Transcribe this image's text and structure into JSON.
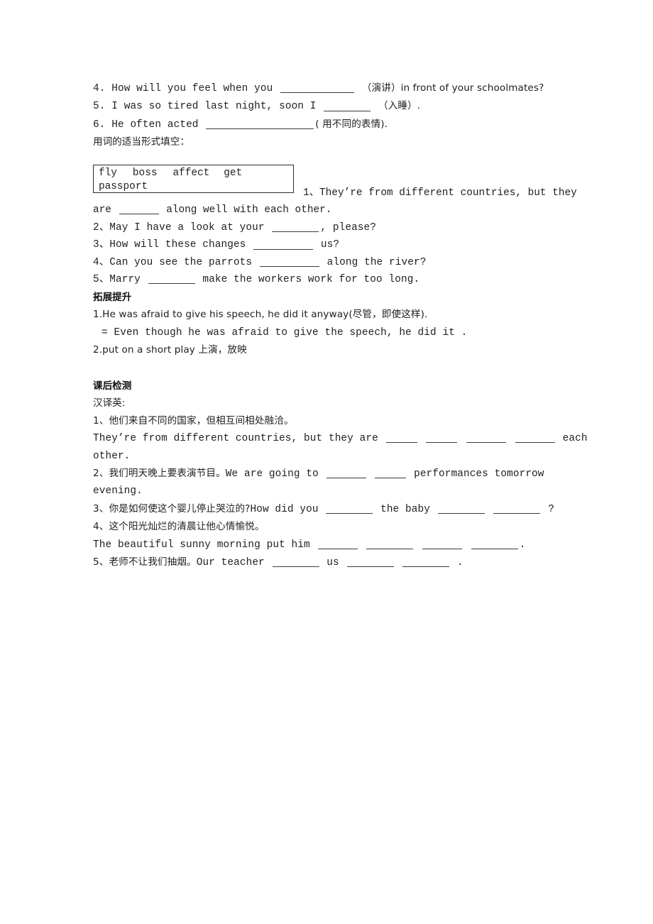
{
  "document": {
    "page_background": "#ffffff",
    "text_color": "#1e1e1e"
  },
  "section_top": {
    "items": [
      {
        "number": "4.",
        "pre": "How will you feel when you",
        "blank": "xl",
        "post": "（演讲）in front of your schoolmates?"
      },
      {
        "number": "5.",
        "pre": "I was so tired last night, soon I",
        "blank": "m",
        "post": "（入睡）."
      },
      {
        "number": "6.",
        "pre": "He often acted",
        "blank": "xxl",
        "post": "( 用不同的表情)."
      }
    ],
    "instruction": "用词的适当形式填空："
  },
  "word_bank": {
    "row1": [
      "fly",
      "boss",
      "affect",
      "get"
    ],
    "row2": [
      "passport"
    ]
  },
  "fill_in_items": [
    {
      "number": "1、",
      "text_part1": "They’re from different countries, but they",
      "text_part2_pre": "are",
      "blank": "s",
      "text_part2_post": "along well with each other."
    },
    {
      "number": "2、",
      "pre": "May I have a look at your",
      "blank": "m",
      "post": ", please?"
    },
    {
      "number": "3、",
      "pre": "How will these changes",
      "blank": "l",
      "post": "us?"
    },
    {
      "number": "4、",
      "pre": "Can you see the parrots",
      "blank": "l",
      "post": "along the river?"
    },
    {
      "number": "5、",
      "pre": "Marry",
      "blank": "m",
      "post": "make the workers work for too long."
    }
  ],
  "extension": {
    "heading": "拓展提升",
    "lines": [
      "1.He was afraid to give his speech, he did it anyway(尽管，即使这样).",
      "= Even though he was afraid to give the speech, he did it .",
      "2.put on a short play   上演，放映"
    ]
  },
  "post_class_test": {
    "heading": "课后检测",
    "subheading": "汉译英:",
    "items": [
      {
        "number": "1、",
        "chinese": "他们来自不同的国家，但相互间相处融洽。",
        "english_pre": "They’re from different countries, but they are",
        "blanks": [
          "xs",
          "xs",
          "s",
          "s"
        ],
        "english_mid": "each",
        "english_post": "other."
      },
      {
        "number": "2、",
        "chinese": "我们明天晚上要表演节目。",
        "english_pre": "We are going to",
        "blanks": [
          "s",
          "xs"
        ],
        "english_mid": "performances tomorrow",
        "english_post": "evening."
      },
      {
        "number": "3、",
        "chinese": "你是如何使这个婴儿停止哭泣的?",
        "english_pre": "How did you",
        "blank1": "m",
        "english_mid": "the baby",
        "blank2": "m",
        "blank3": "m",
        "english_post": "?"
      },
      {
        "number": "4、",
        "chinese": "这个阳光灿烂的清晨让他心情愉悦。",
        "english_pre": "The beautiful sunny morning put him",
        "blanks": [
          "s",
          "m",
          "s",
          "m"
        ],
        "english_post": "."
      },
      {
        "number": "5、",
        "chinese": "老师不让我们抽烟。",
        "english_pre": "Our teacher",
        "blank1": "m",
        "english_mid": "us",
        "blank2": "m",
        "blank3": "m",
        "english_post": "."
      }
    ]
  }
}
